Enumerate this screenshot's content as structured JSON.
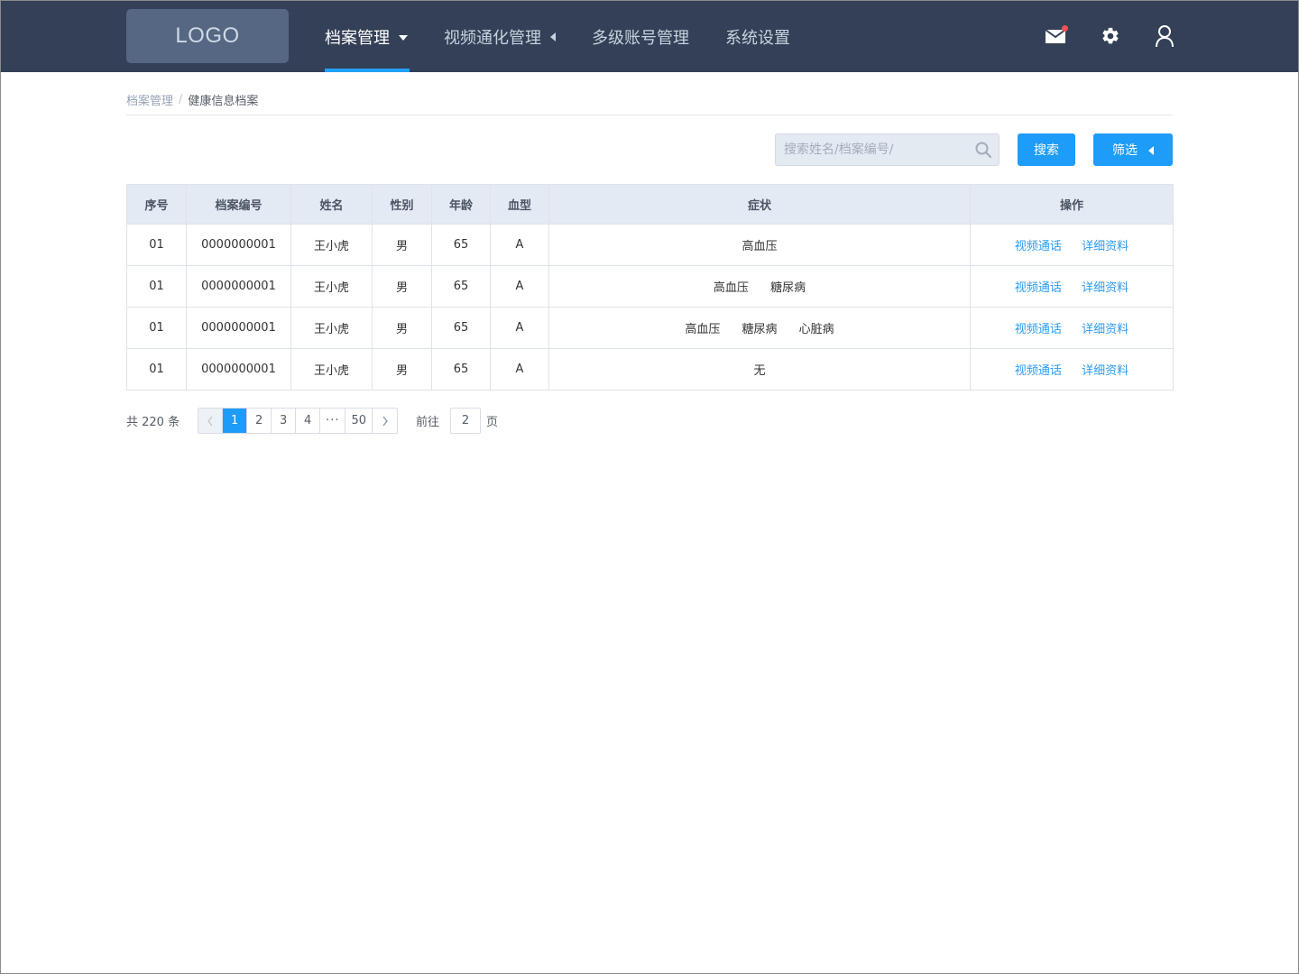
{
  "header": {
    "logo": "LOGO",
    "nav": [
      {
        "label": "档案管理",
        "active": true,
        "caret": "down"
      },
      {
        "label": "视频通化管理",
        "active": false,
        "caret": "left"
      },
      {
        "label": "多级账号管理",
        "active": false,
        "caret": ""
      },
      {
        "label": "系统设置",
        "active": false,
        "caret": ""
      }
    ],
    "icons": [
      "mail-icon",
      "gear-icon",
      "user-icon"
    ],
    "colors": {
      "bar": "#334057",
      "accent": "#22a0ff",
      "notify_dot": "#f15151"
    }
  },
  "breadcrumb": {
    "parent": "档案管理",
    "separator": "/",
    "current": "健康信息档案"
  },
  "toolbar": {
    "search_placeholder": "搜索姓名/档案编号/",
    "search_button": "搜索",
    "filter_button": "筛选"
  },
  "table": {
    "headers": [
      "序号",
      "档案编号",
      "姓名",
      "性别",
      "年龄",
      "血型",
      "症状",
      "操作"
    ],
    "rows": [
      {
        "index": "01",
        "id": "0000000001",
        "name": "王小虎",
        "gender": "男",
        "age": "65",
        "blood": "A",
        "symptoms": [
          "高血压"
        ],
        "actions": [
          "视频通话",
          "详细资料"
        ]
      },
      {
        "index": "01",
        "id": "0000000001",
        "name": "王小虎",
        "gender": "男",
        "age": "65",
        "blood": "A",
        "symptoms": [
          "高血压",
          "糖尿病"
        ],
        "actions": [
          "视频通话",
          "详细资料"
        ]
      },
      {
        "index": "01",
        "id": "0000000001",
        "name": "王小虎",
        "gender": "男",
        "age": "65",
        "blood": "A",
        "symptoms": [
          "高血压",
          "糖尿病",
          "心脏病"
        ],
        "actions": [
          "视频通话",
          "详细资料"
        ]
      },
      {
        "index": "01",
        "id": "0000000001",
        "name": "王小虎",
        "gender": "男",
        "age": "65",
        "blood": "A",
        "symptoms": [
          "无"
        ],
        "actions": [
          "视频通话",
          "详细资料"
        ]
      }
    ]
  },
  "pagination": {
    "total_text": "共 220 条",
    "pages": [
      "1",
      "2",
      "3",
      "4",
      "···",
      "50"
    ],
    "current_page": "1",
    "goto_prefix": "前往",
    "goto_value": "2",
    "goto_suffix": "页"
  }
}
